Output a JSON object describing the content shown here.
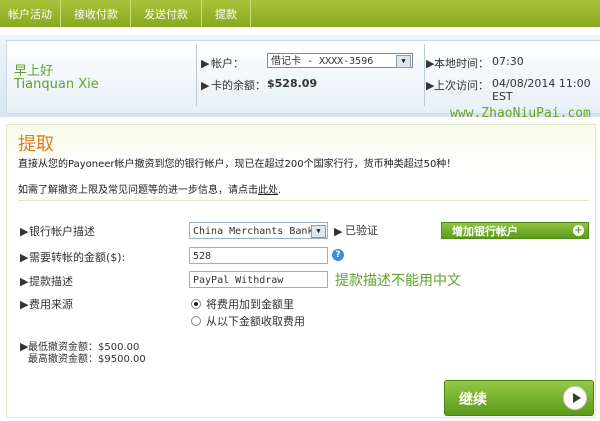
{
  "nav": {
    "tabs": [
      "帐户活动",
      "接收付款",
      "发送付款",
      "提款"
    ]
  },
  "header": {
    "greeting": "早上好",
    "user_name": "Tianquan Xie",
    "account_label": "帐户：",
    "account_value": "借记卡 - XXXX-3596",
    "balance_label": "卡的余额：",
    "balance_value": "$528.09",
    "local_time_label": "本地时间：",
    "local_time_value": "07:30",
    "last_visit_label": "上次访问：",
    "last_visit_value": "04/08/2014 11:00 EST"
  },
  "watermark": "www.ZhaoNiuPai.com",
  "form": {
    "title": "提取",
    "intro_line1": "直接从您的Payoneer帐户撤资到您的银行帐户，现已在超过200个国家行行，货币种类超过50种！",
    "intro_line2_prefix": "如需了解撤资上限及常见问题等的进一步信息，请点击",
    "intro_line2_link": "此处",
    "intro_line2_suffix": ".",
    "bank_label": "银行帐户描述",
    "bank_value": "China Merchants Bank",
    "verified_label": "已验证",
    "add_bank_label": "增加银行帐户",
    "amount_label": "需要转帐的金额($):",
    "amount_value": "528",
    "desc_label": "提款描述",
    "desc_value": "PayPal Withdraw",
    "desc_note": "提款描述不能用中文",
    "fee_label": "费用来源",
    "fee_options": [
      "将费用加到金额里",
      "从以下金额收取费用"
    ],
    "fee_selected_index": 0,
    "min_label": "最低撤资金额：$500.00",
    "max_label": "最高撤资金额：$9500.00",
    "continue_label": "继续"
  },
  "colors": {
    "nav_green": "#8fb02a",
    "accent_orange": "#e07c1c",
    "greeting_green": "#5fa22e",
    "button_green": "#6aaa2a"
  }
}
